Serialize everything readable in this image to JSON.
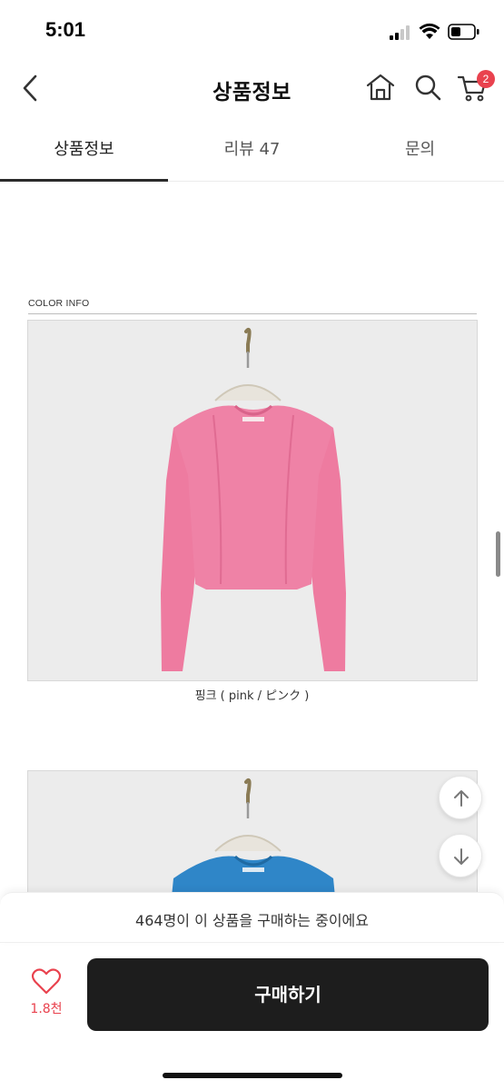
{
  "status_bar": {
    "time": "5:01"
  },
  "header": {
    "title": "상품정보",
    "icons": [
      "back-icon",
      "home-icon",
      "search-icon",
      "cart-icon"
    ],
    "cart_badge": "2"
  },
  "tabs": [
    {
      "label": "상품정보",
      "active": true
    },
    {
      "label": "리뷰 47",
      "active": false
    },
    {
      "label": "문의",
      "active": false
    }
  ],
  "content": {
    "section_label": "COLOR INFO",
    "products": [
      {
        "caption": "핑크 ( pink / ピンク )",
        "garment_color": "#ee7ba0"
      },
      {
        "caption": "",
        "garment_color": "#2f86c8"
      }
    ]
  },
  "bottom": {
    "buyers_text": "464명이 이 상품을 구매하는 중이에요",
    "like_count": "1.8천",
    "buy_label": "구매하기"
  },
  "colors": {
    "accent": "#e9424e",
    "buy_button": "#1d1d1d",
    "photo_bg": "#ececec"
  }
}
